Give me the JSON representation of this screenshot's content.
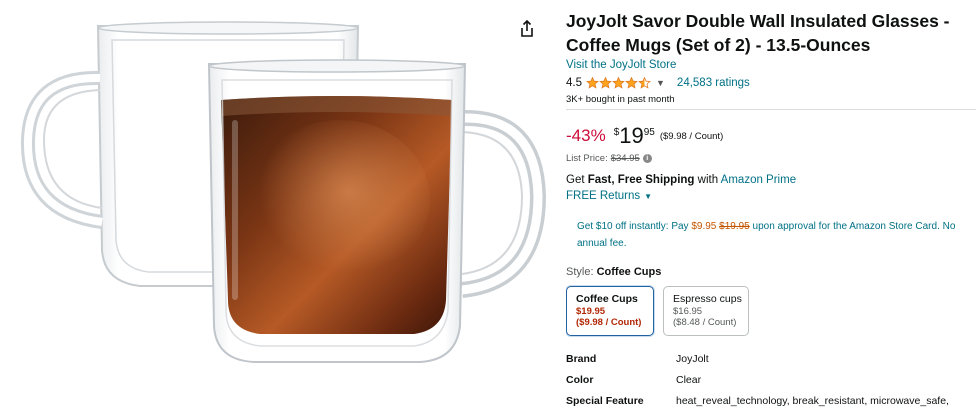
{
  "product": {
    "title": "JoyJolt Savor Double Wall Insulated Glasses - Coffee Mugs (Set of 2) - 13.5-Ounces",
    "store_link": "Visit the JoyJolt Store",
    "rating": "4.5",
    "rating_value": 4.5,
    "ratings_count": "24,583 ratings",
    "bought": "3K+ bought in past month"
  },
  "price": {
    "discount": "-43%",
    "currency": "$",
    "whole": "19",
    "fraction": "95",
    "unit_price": "($9.98 / Count)",
    "list_label": "List Price:",
    "list_value": "$34.95"
  },
  "shipping": {
    "prefix": "Get ",
    "bold": "Fast, Free Shipping",
    "middle": " with ",
    "link": "Amazon Prime",
    "returns": "FREE Returns"
  },
  "promo": {
    "text1": "Get $10 off instantly: Pay ",
    "new_price": "$9.95",
    "old_price": "$19.95",
    "text2": " upon approval for the Amazon Store Card. No annual fee."
  },
  "style": {
    "label": "Style:",
    "selected": "Coffee Cups",
    "options": [
      {
        "name": "Coffee Cups",
        "price": "$19.95",
        "unit": "($9.98 / Count)"
      },
      {
        "name": "Espresso cups",
        "price": "$16.95",
        "unit": "($8.48 / Count)"
      }
    ]
  },
  "specs": [
    {
      "key": "Brand",
      "value": "JoyJolt"
    },
    {
      "key": "Color",
      "value": "Clear"
    },
    {
      "key": "Special Feature",
      "value": "heat_reveal_technology, break_resistant, microwave_safe,"
    }
  ],
  "colors": {
    "link": "#007185",
    "discount": "#cc0c39",
    "star": "#ffa41c",
    "selected_border": "#2162a1",
    "deal_price": "#b12704"
  },
  "icons": {
    "share": "share-icon",
    "info": "info-icon",
    "chevron": "chevron-down-icon",
    "star": "star-icon"
  }
}
